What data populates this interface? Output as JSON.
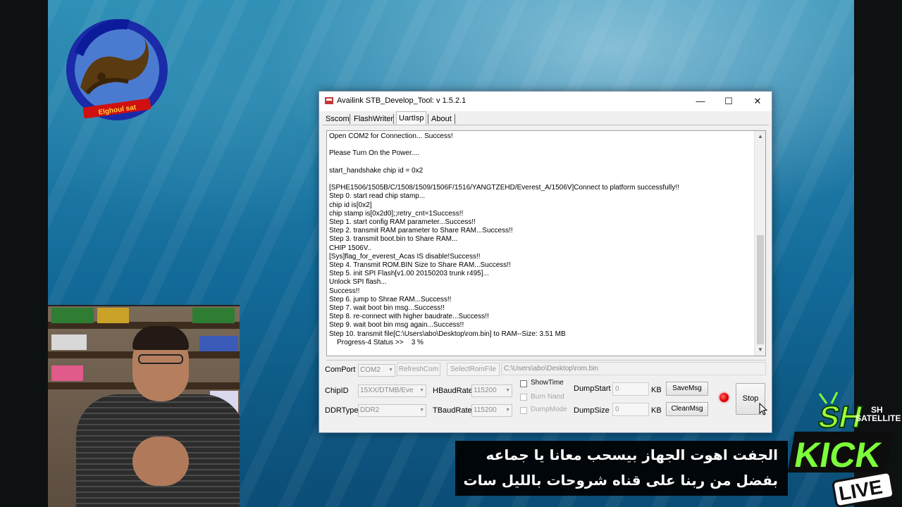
{
  "overlay": {
    "logo_text": "Elghoul sat",
    "subtitle_line1": "الجفت اهوت الجهاز بيسحب معانا يا جماعه",
    "subtitle_line2": "بفضل من ربنا على قناه شروحات بالليل سات",
    "badge_sh": "SH",
    "badge_sh_small": "SH",
    "badge_satellite": "SATELLITE",
    "badge_kick": "KICK",
    "badge_live": "LIVE"
  },
  "window": {
    "title": "Availink STB_Develop_Tool: v 1.5.2.1",
    "controls": {
      "minimize": "—",
      "maximize": "☐",
      "close": "✕"
    },
    "tabs": [
      {
        "label": "Sscom"
      },
      {
        "label": "FlashWriter"
      },
      {
        "label": "UartIsp"
      },
      {
        "label": "About"
      }
    ],
    "log_lines": [
      "Open COM2 for Connection... Success!",
      "",
      "Please Turn On the Power....",
      "",
      "start_handshake chip id = 0x2",
      "",
      "[SPHE1506/1505B/C/1508/1509/1506F/1516/YANGTZEHD/Everest_A/1506V]Connect to platform successfully!!",
      "Step 0. start read chip stamp...",
      "chip id is[0x2]",
      "chip stamp is[0x2d0];;retry_cnt=1Success!!",
      "Step 1. start config RAM parameter...Success!!",
      "Step 2. transmit RAM parameter to Share RAM...Success!!",
      "Step 3. transmit boot.bin to Share RAM...",
      "CHIP 1506V..",
      "[Sys]flag_for_everest_Acas IS disable!Success!!",
      "Step 4. Transmit ROM.BIN Size to Share RAM...Success!!",
      "Step 5. init SPI Flash[v1.00 20150203 trunk r495]...",
      "Unlock SPI flash...",
      "Success!!",
      "Step 6. jump to Shrae RAM...Success!!",
      "Step 7. wait boot bin msg...Success!!",
      "Step 8. re-connect with higher baudrate...Success!!",
      "Step 9. wait boot bin msg again...Success!!",
      "Step 10. transmit file[C:\\Users\\abo\\Desktop\\rom.bin] to RAM--Size: 3.51 MB",
      "    Progress-4 Status >>    3 %"
    ],
    "controls_panel": {
      "comport_label": "ComPort",
      "comport_value": "COM2",
      "refresh_label": "RefreshCom",
      "select_rom_label": "SelectRomFile",
      "rom_path": "C:\\Users\\abo\\Desktop\\rom.bin",
      "chipid_label": "ChipID",
      "chipid_value": "15XX/DTMB/Eve",
      "hbaud_label": "HBaudRate",
      "hbaud_value": "115200",
      "ddrtype_label": "DDRType",
      "ddrtype_value": "DDR2",
      "tbaud_label": "TBaudRate",
      "tbaud_value": "115200",
      "showtime_label": "ShowTime",
      "burnnand_label": "Burn Nand",
      "dumpmode_label": "DumpMode",
      "dumpstart_label": "DumpStart",
      "dumpstart_value": "0",
      "dumpsize_label": "DumpSize",
      "dumpsize_value": "0",
      "kb_label_1": "KB",
      "kb_label_2": "KB",
      "savemsg_label": "SaveMsg",
      "cleanmsg_label": "CleanMsg",
      "stop_label": "Stop"
    }
  }
}
